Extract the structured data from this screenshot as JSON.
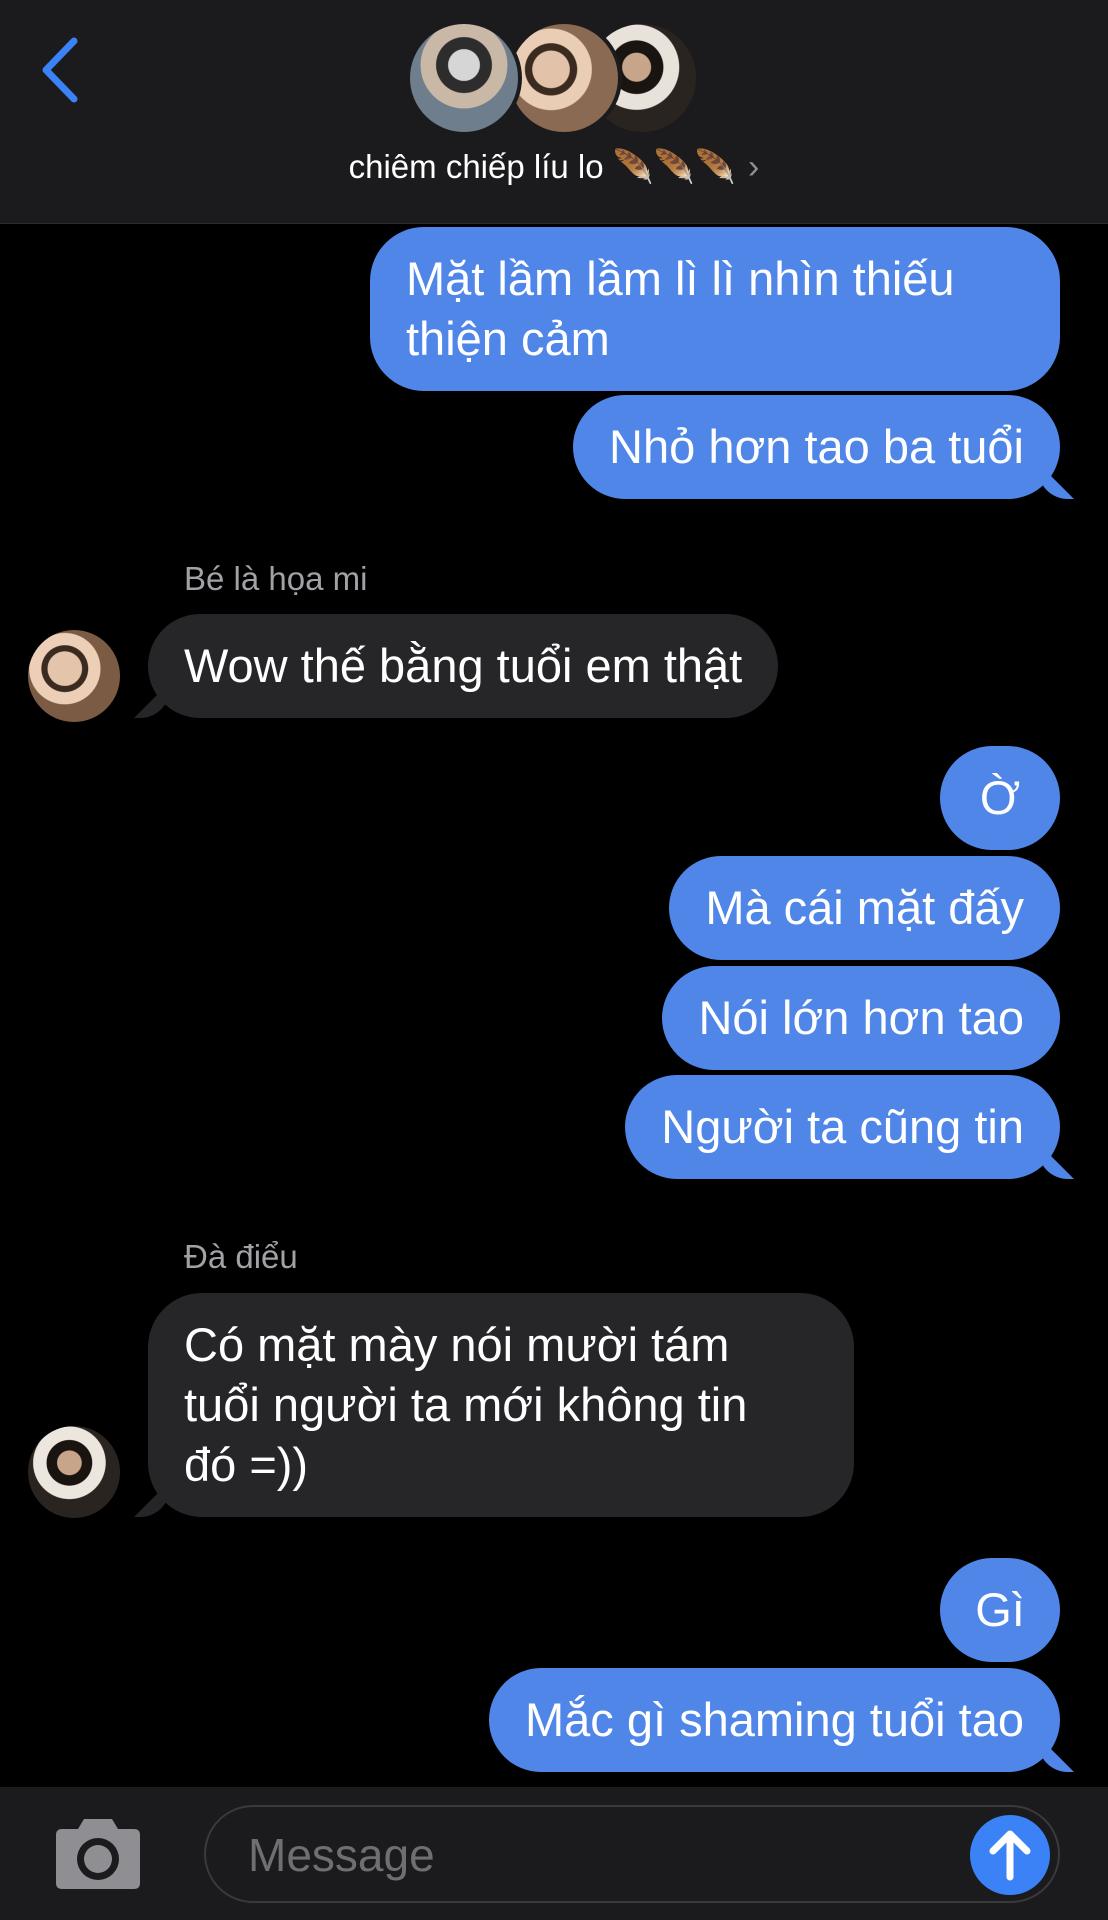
{
  "header": {
    "back_icon": "chevron-left-icon",
    "group_name": "chiêm chiếp líu lo 🪶🪶🪶",
    "chevron": "›",
    "avatars": [
      "member-avatar-1",
      "member-avatar-2",
      "member-avatar-3"
    ]
  },
  "messages": [
    {
      "text_line1": "Mặt lầm lầm lì lì nhìn thiếu",
      "text_line2": "thiện cảm"
    },
    {
      "text": "Nhỏ hơn tao ba tuổi"
    },
    {
      "sender": "Bé là họa mi",
      "text": "Wow thế bằng tuổi em thật"
    },
    {
      "text": "Ờ"
    },
    {
      "text": "Mà cái mặt đấy"
    },
    {
      "text": "Nói lớn hơn tao"
    },
    {
      "text": "Người ta cũng tin"
    },
    {
      "sender": "Đà điểu",
      "text_line1": "Có mặt mày nói mười tám",
      "text_line2": "tuổi người ta mới không tin",
      "text_line3": "đó =))"
    },
    {
      "text": "Gì"
    },
    {
      "text": "Mắc gì shaming tuổi tao"
    }
  ],
  "composer": {
    "placeholder": "Message",
    "camera_icon": "camera-icon",
    "send_icon": "arrow-up-icon"
  },
  "colors": {
    "outgoing_bubble": "#4f86e8",
    "incoming_bubble": "#262629",
    "background": "#000000",
    "header": "#1b1b1d"
  }
}
